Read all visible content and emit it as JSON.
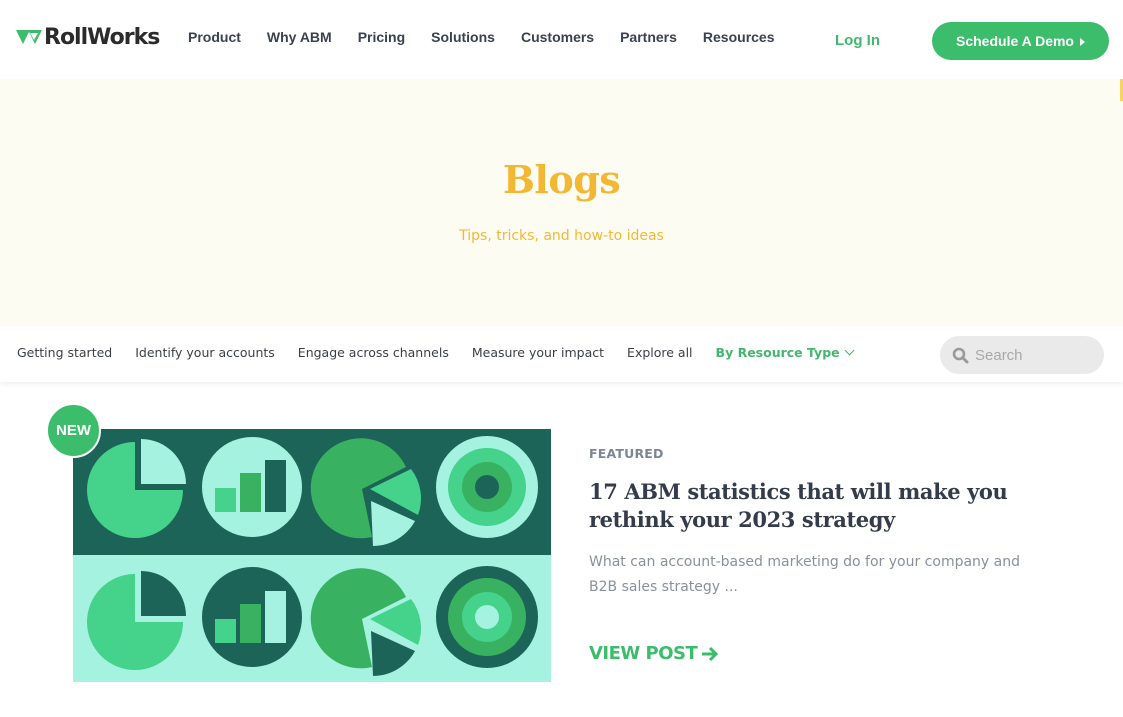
{
  "header": {
    "brand": "RollWorks",
    "nav": [
      "Product",
      "Why ABM",
      "Pricing",
      "Solutions",
      "Customers",
      "Partners",
      "Resources"
    ],
    "login_label": "Log In",
    "cta_label": "Schedule A Demo"
  },
  "hero": {
    "title": "Blogs",
    "subtitle": "Tips, tricks, and how-to ideas"
  },
  "filters": {
    "items": [
      "Getting started",
      "Identify your accounts",
      "Engage across channels",
      "Measure your impact",
      "Explore all"
    ],
    "dropdown_label": "By Resource Type",
    "search_placeholder": "Search"
  },
  "featured_post": {
    "badge": "NEW",
    "eyebrow": "FEATURED",
    "title": "17 ABM statistics that will make you rethink your 2023 strategy",
    "excerpt": "What can account-based marketing do for your company and B2B sales strategy ...",
    "cta": "VIEW POST",
    "image_icons": [
      "pie-chart",
      "bar-chart",
      "exploded-pie-chart",
      "target-rings"
    ]
  },
  "colors": {
    "brand_green": "#3cbd6c",
    "hero_yellow": "#f2b834",
    "hero_bg": "#fdfcf2",
    "dark_teal": "#1d6458",
    "mint": "#a4f2df",
    "mid_green": "#45d28b",
    "deep_green": "#38b260"
  }
}
